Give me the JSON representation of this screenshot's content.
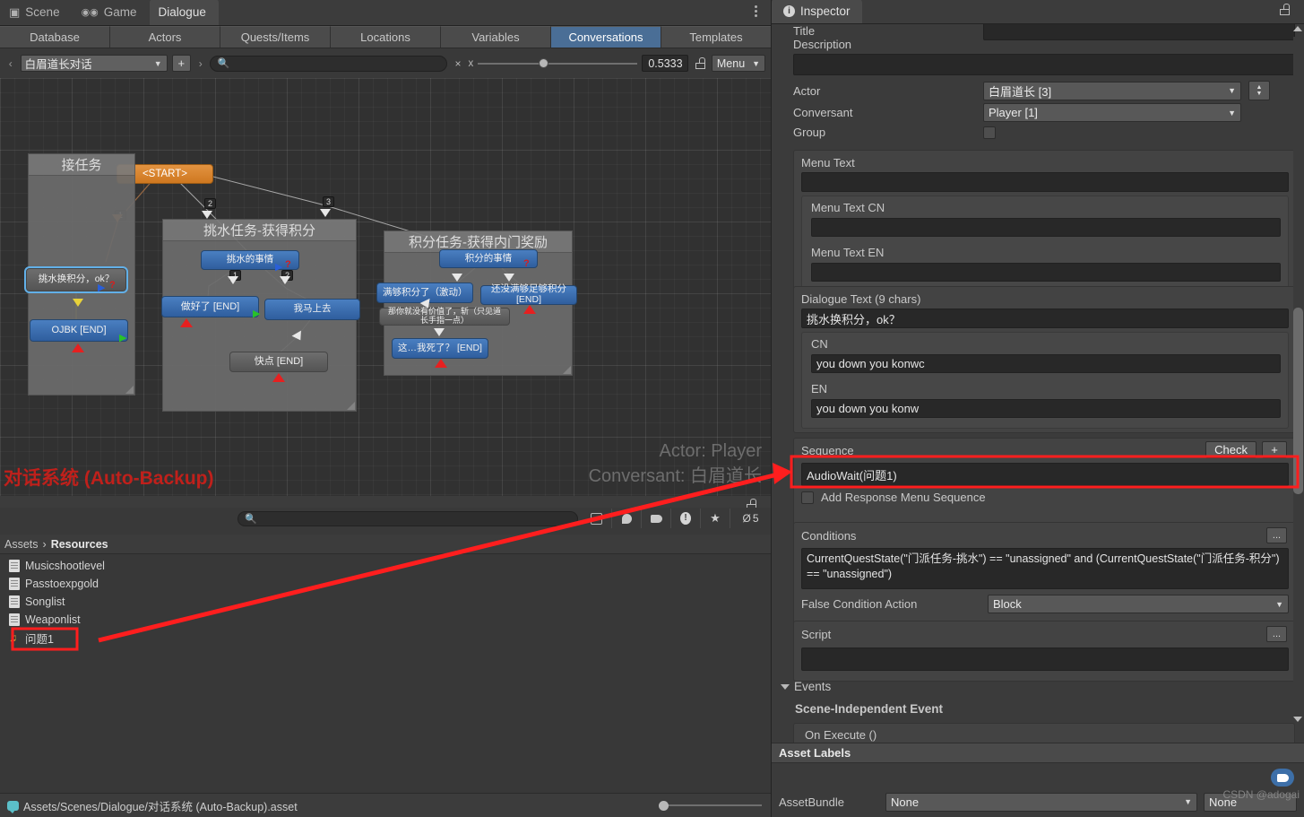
{
  "window": {
    "tabs": [
      {
        "label": "Scene",
        "icon": "grid-icon",
        "active": false
      },
      {
        "label": "Game",
        "icon": "gamepad-icon",
        "active": false
      },
      {
        "label": "Dialogue",
        "icon": "none",
        "active": true
      }
    ],
    "kebab": "more-options"
  },
  "database_tabs": [
    {
      "label": "Database",
      "active": false
    },
    {
      "label": "Actors",
      "active": false
    },
    {
      "label": "Quests/Items",
      "active": false
    },
    {
      "label": "Locations",
      "active": false
    },
    {
      "label": "Variables",
      "active": false
    },
    {
      "label": "Conversations",
      "active": true
    },
    {
      "label": "Templates",
      "active": false
    }
  ],
  "dialogue_toolbar": {
    "prev_arrow": "‹",
    "next_arrow": "›",
    "conversation": "白眉道长对话",
    "add_label": "+",
    "search_value": "",
    "search_placeholder": "",
    "clear_label": "×",
    "zoom_axis_label": "x",
    "zoom_value": "0.5333",
    "menu_label": "Menu"
  },
  "canvas": {
    "watermark_title": "对话系统 (Auto-Backup)",
    "watermark_actor": "Actor: Player",
    "watermark_conversant": "Conversant: 白眉道长",
    "start_node": "<START>",
    "link_numbers": [
      "1",
      "2",
      "3"
    ],
    "groups": [
      {
        "title": "接任务",
        "nodes": [
          {
            "text": "挑水换积分，ok？",
            "type": "gray",
            "selected": true
          },
          {
            "text": "OJBK [END]",
            "type": "blue",
            "selected": false
          }
        ]
      },
      {
        "title": "挑水任务-获得积分",
        "nodes": [
          {
            "text": "挑水的事情",
            "type": "blue",
            "selected": false
          },
          {
            "text": "做好了 [END]",
            "type": "blue",
            "selected": false
          },
          {
            "text": "我马上去",
            "type": "blue",
            "selected": false
          },
          {
            "text": "快点 [END]",
            "type": "gray",
            "selected": false
          }
        ],
        "inner_numbers": [
          "1",
          "2"
        ]
      },
      {
        "title": "积分任务-获得内门奖励",
        "nodes": [
          {
            "text": "积分的事情",
            "type": "blue",
            "selected": false
          },
          {
            "text": "满够积分了（激动）",
            "type": "blue",
            "selected": false
          },
          {
            "text": "还没满够足够积分 [END]",
            "type": "blue",
            "selected": false
          },
          {
            "text": "那你就没有价值了，斩（只见道长手指一点）",
            "type": "gray",
            "selected": false
          },
          {
            "text": "这…我死了？ [END]",
            "type": "blue",
            "selected": false
          }
        ]
      }
    ]
  },
  "project": {
    "search_value": "",
    "search_placeholder": "",
    "filter_icons": [
      "save-search-icon",
      "asset-type-icon",
      "label-icon",
      "warning-icon",
      "favorite-icon",
      "hidden-icon"
    ],
    "hidden_count": "5",
    "breadcrumb": [
      "Assets",
      "Resources"
    ],
    "breadcrumb_sep": "›",
    "assets": [
      {
        "name": "Musicshootlevel",
        "icon": "text-asset-icon",
        "highlighted": false
      },
      {
        "name": "Passtoexpgold",
        "icon": "text-asset-icon",
        "highlighted": false
      },
      {
        "name": "Songlist",
        "icon": "text-asset-icon",
        "highlighted": false
      },
      {
        "name": "Weaponlist",
        "icon": "text-asset-icon",
        "highlighted": false
      },
      {
        "name": "问题1",
        "icon": "audio-clip-icon",
        "highlighted": true
      }
    ]
  },
  "statusbar": {
    "path": "Assets/Scenes/Dialogue/对话系统 (Auto-Backup).asset"
  },
  "inspector": {
    "tab_label": "Inspector",
    "title_label": "Title",
    "title_value": "",
    "description_label": "Description",
    "description_value": "",
    "actor_label": "Actor",
    "actor_value": "白眉道长 [3]",
    "conversant_label": "Conversant",
    "conversant_value": "Player [1]",
    "group_label": "Group",
    "group_checked": false,
    "menu_text_label": "Menu Text",
    "menu_text_value": "",
    "menu_text_cn_label": "Menu Text CN",
    "menu_text_cn_value": "",
    "menu_text_en_label": "Menu Text EN",
    "menu_text_en_value": "",
    "dialogue_text_label": "Dialogue Text (9 chars)",
    "dialogue_text_value": "挑水换积分，ok？",
    "cn_label": "CN",
    "cn_value": "you down you konwc",
    "en_label": "EN",
    "en_value": "you down you konw",
    "sequence_label": "Sequence",
    "sequence_check_label": "Check",
    "sequence_add_label": "+",
    "sequence_value": "AudioWait(问题1)",
    "add_response_menu_label": "Add Response Menu Sequence",
    "add_response_menu_checked": false,
    "conditions_label": "Conditions",
    "conditions_dots": "...",
    "conditions_value": "CurrentQuestState(\"门派任务-挑水\") == \"unassigned\" and (CurrentQuestState(\"门派任务-积分\") == \"unassigned\")",
    "false_condition_label": "False Condition Action",
    "false_condition_value": "Block",
    "script_label": "Script",
    "script_dots": "...",
    "script_value": "",
    "events_label": "Events",
    "scene_independent_label": "Scene-Independent Event",
    "on_execute_label": "On Execute ()",
    "asset_labels_label": "Asset Labels",
    "assetbundle_label": "AssetBundle",
    "assetbundle_value": "None",
    "assetbundle_variant": "None"
  },
  "watermark": "CSDN @adogai",
  "colors": {
    "accent_blue": "#4a6e96",
    "node_blue": "#3a6cb0",
    "start_orange": "#d7831f",
    "annotation_red": "#ff1e1e",
    "selection": "#62b0e8"
  }
}
